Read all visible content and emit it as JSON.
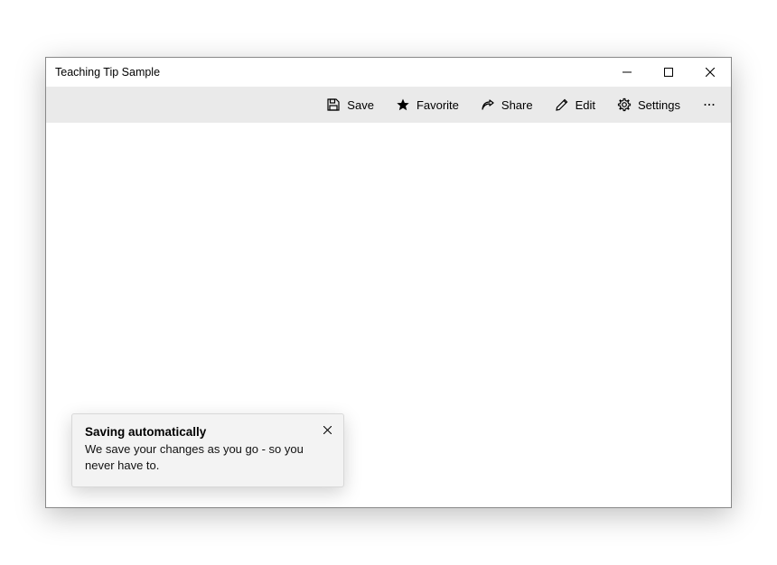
{
  "window": {
    "title": "Teaching Tip Sample"
  },
  "commands": {
    "save": "Save",
    "favorite": "Favorite",
    "share": "Share",
    "edit": "Edit",
    "settings": "Settings"
  },
  "tip": {
    "title": "Saving automatically",
    "subtitle": "We save your changes as you go - so you never have to."
  }
}
